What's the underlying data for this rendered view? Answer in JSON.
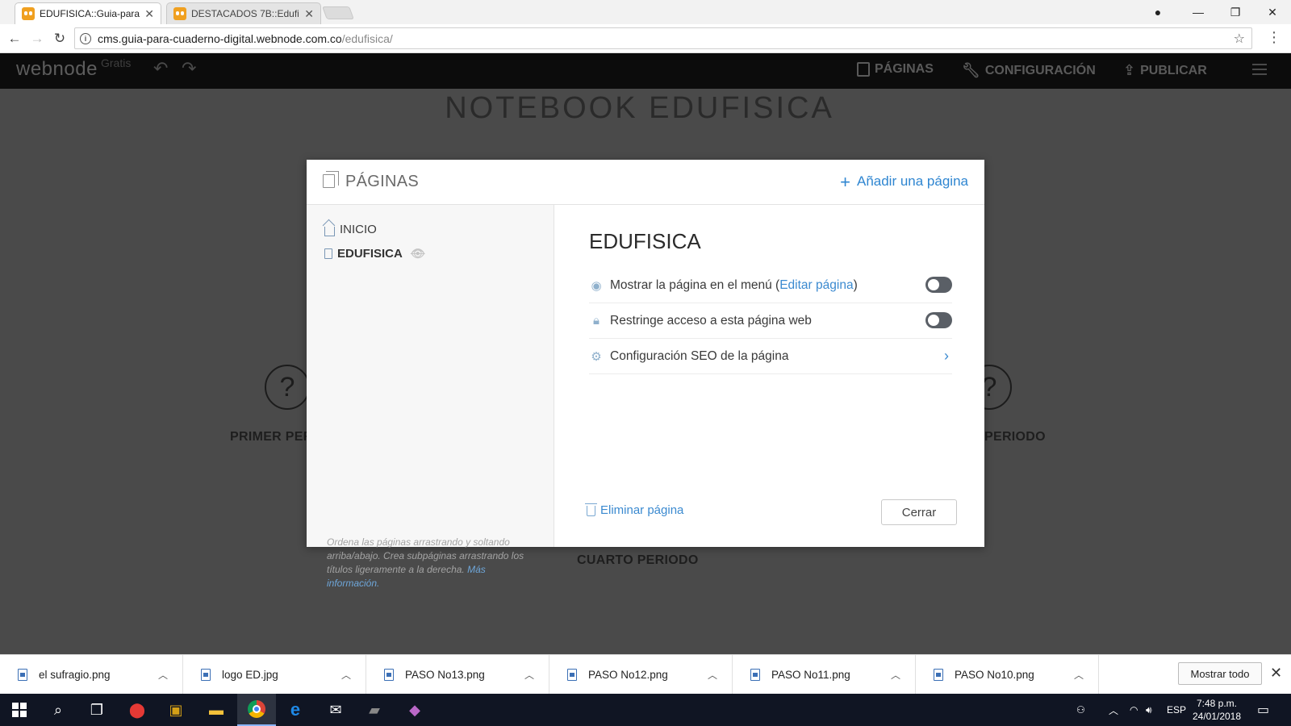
{
  "browser": {
    "tabs": [
      {
        "title": "EDUFISICA::Guia-para-cu",
        "active": true
      },
      {
        "title": "DESTACADOS 7B::Edufisi",
        "active": false
      }
    ],
    "url_host": "cms.guia-para-cuaderno-digital.webnode.com.co",
    "url_path": "/edufisica/"
  },
  "webnode": {
    "logo": "webnode",
    "plan": "Gratis",
    "menu": {
      "pages": "PÁGINAS",
      "settings": "CONFIGURACIÓN",
      "publish": "PUBLICAR"
    }
  },
  "site": {
    "title": "NOTEBOOK EDUFISICA",
    "period_left": "PRIMER PER",
    "period_right": "PERIODO",
    "period_bottom": "CUARTO PERIODO"
  },
  "modal": {
    "title": "PÁGINAS",
    "add_page": "Añadir una página",
    "pages": [
      {
        "label": "INICIO",
        "icon": "home-icon"
      },
      {
        "label": "EDUFISICA",
        "icon": "page-icon",
        "hidden": true
      }
    ],
    "hint_text": "Ordena las páginas arrastrando y soltando arriba/abajo. Crea subpáginas arrastrando los títulos ligeramente a la derecha.",
    "hint_link": "Más información.",
    "selected_title": "EDUFISICA",
    "settings": {
      "show_in_menu_prefix": "Mostrar la página en el menú (",
      "show_in_menu_link": "Editar página",
      "show_in_menu_suffix": ")",
      "show_in_menu_on": false,
      "restrict_access": "Restringe acceso a esta página web",
      "restrict_access_on": false,
      "seo": "Configuración SEO de la página"
    },
    "delete_page": "Eliminar página",
    "close": "Cerrar"
  },
  "downloads": {
    "files": [
      "el sufragio.png",
      "logo ED.jpg",
      "PASO No13.png",
      "PASO No12.png",
      "PASO No11.png",
      "PASO No10.png"
    ],
    "show_all": "Mostrar todo"
  },
  "taskbar": {
    "language": "ESP",
    "time": "7:48 p.m.",
    "date": "24/01/2018"
  }
}
